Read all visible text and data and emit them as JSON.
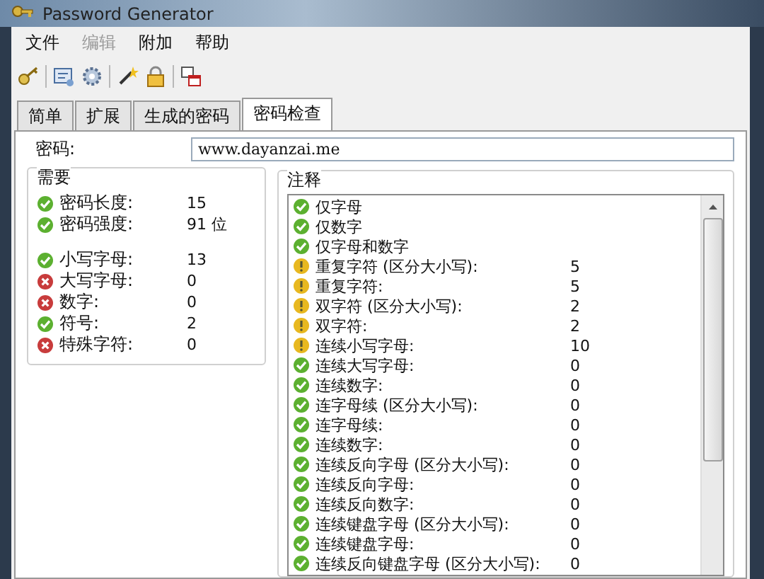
{
  "window": {
    "title": "Password Generator"
  },
  "menu": [
    {
      "label": "文件",
      "disabled": false
    },
    {
      "label": "编辑",
      "disabled": true
    },
    {
      "label": "附加",
      "disabled": false
    },
    {
      "label": "帮助",
      "disabled": false
    }
  ],
  "toolbar": [
    {
      "kind": "key"
    },
    {
      "kind": "sep"
    },
    {
      "kind": "card"
    },
    {
      "kind": "gear"
    },
    {
      "kind": "sep"
    },
    {
      "kind": "wand"
    },
    {
      "kind": "lock"
    },
    {
      "kind": "sep"
    },
    {
      "kind": "windows"
    }
  ],
  "tabs": [
    {
      "label": "简单",
      "selected": false
    },
    {
      "label": "扩展",
      "selected": false
    },
    {
      "label": "生成的密码",
      "selected": false
    },
    {
      "label": "密码检查",
      "selected": true
    }
  ],
  "password": {
    "label": "密码:",
    "value": "www.dayanzai.me"
  },
  "requirements": {
    "title": "需要",
    "sections": [
      {
        "items": [
          {
            "kind": "ok",
            "label": "密码长度:",
            "value": "15"
          },
          {
            "kind": "ok",
            "label": "密码强度:",
            "value": "91 位"
          }
        ]
      },
      {
        "items": [
          {
            "kind": "ok",
            "label": "小写字母:",
            "value": "13"
          },
          {
            "kind": "error",
            "label": "大写字母:",
            "value": "0"
          },
          {
            "kind": "error",
            "label": "数字:",
            "value": "0"
          },
          {
            "kind": "ok",
            "label": "符号:",
            "value": "2"
          },
          {
            "kind": "error",
            "label": "特殊字符:",
            "value": "0"
          }
        ]
      }
    ]
  },
  "notes": {
    "title": "注释",
    "items": [
      {
        "kind": "ok",
        "label": "仅字母"
      },
      {
        "kind": "ok",
        "label": "仅数字"
      },
      {
        "kind": "ok",
        "label": "仅字母和数字"
      },
      {
        "kind": "warn",
        "label": "重复字符 (区分大小写):",
        "value": "5"
      },
      {
        "kind": "warn",
        "label": "重复字符:",
        "value": "5"
      },
      {
        "kind": "warn",
        "label": "双字符 (区分大小写):",
        "value": "2"
      },
      {
        "kind": "warn",
        "label": "双字符:",
        "value": "2"
      },
      {
        "kind": "warn",
        "label": "连续小写字母:",
        "value": "10"
      },
      {
        "kind": "ok",
        "label": "连续大写字母:",
        "value": "0"
      },
      {
        "kind": "ok",
        "label": "连续数字:",
        "value": "0"
      },
      {
        "kind": "ok",
        "label": "连字母续 (区分大小写):",
        "value": "0"
      },
      {
        "kind": "ok",
        "label": "连字母续:",
        "value": "0"
      },
      {
        "kind": "ok",
        "label": "连续数字:",
        "value": "0"
      },
      {
        "kind": "ok",
        "label": "连续反向字母 (区分大小写):",
        "value": "0"
      },
      {
        "kind": "ok",
        "label": "连续反向字母:",
        "value": "0"
      },
      {
        "kind": "ok",
        "label": "连续反向数字:",
        "value": "0"
      },
      {
        "kind": "ok",
        "label": "连续键盘字母 (区分大小写):",
        "value": "0"
      },
      {
        "kind": "ok",
        "label": "连续键盘字母:",
        "value": "0"
      },
      {
        "kind": "ok",
        "label": "连续反向键盘字母 (区分大小写):",
        "value": "0"
      }
    ]
  }
}
